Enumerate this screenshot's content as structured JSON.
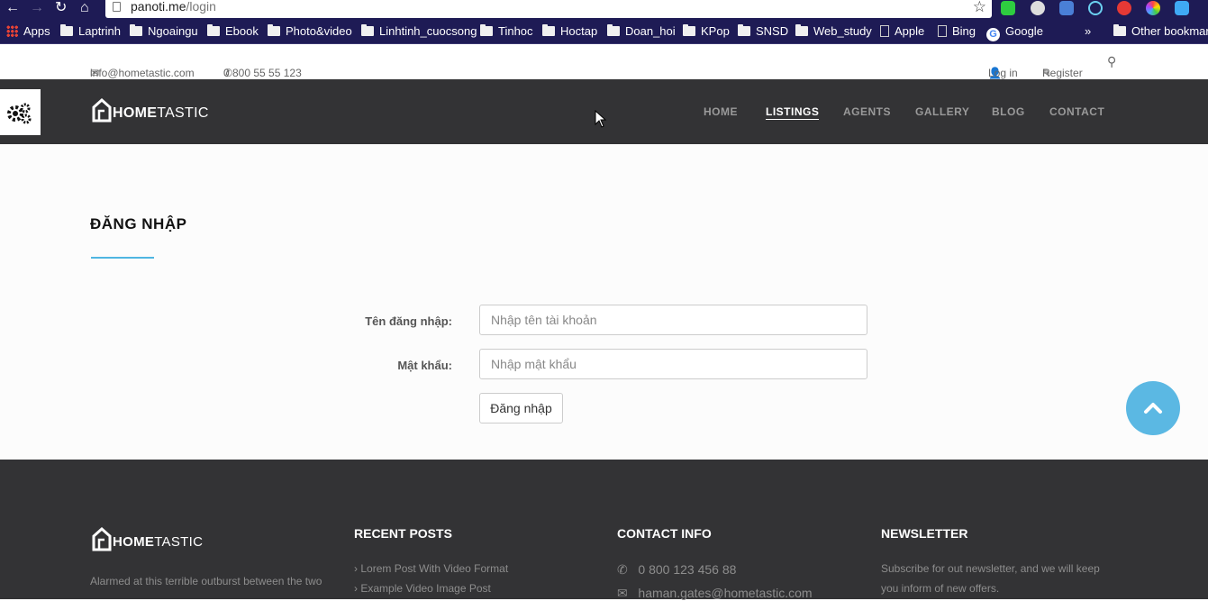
{
  "browser": {
    "url_host": "panoti.me",
    "url_path": "/login",
    "bookmarks": [
      {
        "label": "Apps",
        "icon": "apps-grid-icon"
      },
      {
        "label": "Laptrinh",
        "icon": "folder-icon"
      },
      {
        "label": "Ngoaingu",
        "icon": "folder-icon"
      },
      {
        "label": "Ebook",
        "icon": "folder-icon"
      },
      {
        "label": "Photo&video",
        "icon": "folder-icon"
      },
      {
        "label": "Linhtinh_cuocsong",
        "icon": "folder-icon"
      },
      {
        "label": "Tinhoc",
        "icon": "folder-icon"
      },
      {
        "label": "Hoctap",
        "icon": "folder-icon"
      },
      {
        "label": "Doan_hoi",
        "icon": "folder-icon"
      },
      {
        "label": "KPop",
        "icon": "folder-icon"
      },
      {
        "label": "SNSD",
        "icon": "folder-icon"
      },
      {
        "label": "Web_study",
        "icon": "folder-icon"
      },
      {
        "label": "Apple",
        "icon": "page-icon"
      },
      {
        "label": "Bing",
        "icon": "page-icon"
      },
      {
        "label": "Google",
        "icon": "google-icon"
      }
    ],
    "more": "»",
    "other_bookmarks": "Other bookmarks"
  },
  "topbar": {
    "email": "info@hometastic.com",
    "phone": "0 800 55 55 123",
    "login": "Log in",
    "register": "Register"
  },
  "header": {
    "logo_bold": "HOME",
    "logo_light": "TASTIC",
    "menu": [
      {
        "label": "HOME",
        "active": false
      },
      {
        "label": "LISTINGS",
        "active": true
      },
      {
        "label": "AGENTS",
        "active": false
      },
      {
        "label": "GALLERY",
        "active": false
      },
      {
        "label": "BLOG",
        "active": false
      },
      {
        "label": "CONTACT",
        "active": false
      }
    ]
  },
  "login": {
    "title": "ĐĂNG NHẬP",
    "username_label": "Tên đăng nhập:",
    "username_placeholder": "Nhập tên tài khoản",
    "password_label": "Mật khẩu:",
    "password_placeholder": "Nhập mật khẩu",
    "submit": "Đăng nhập"
  },
  "footer": {
    "logo_bold": "HOME",
    "logo_light": "TASTIC",
    "about_text": "Alarmed at this terrible outburst between the two",
    "recent_posts_title": "RECENT POSTS",
    "recent_posts": [
      "Lorem Post With Video Format",
      "Example Video Image Post"
    ],
    "contact_title": "CONTACT INFO",
    "contact_phone": "0 800 123 456 88",
    "contact_email": "haman.gates@hometastic.com",
    "newsletter_title": "NEWSLETTER",
    "newsletter_line1": "Subscribe for out newsletter, and we will keep",
    "newsletter_line2": "you inform of new offers."
  },
  "colors": {
    "accent": "#5bb8e3",
    "header_bg": "#333335",
    "bookmark_bar_bg": "#1e1b55"
  }
}
